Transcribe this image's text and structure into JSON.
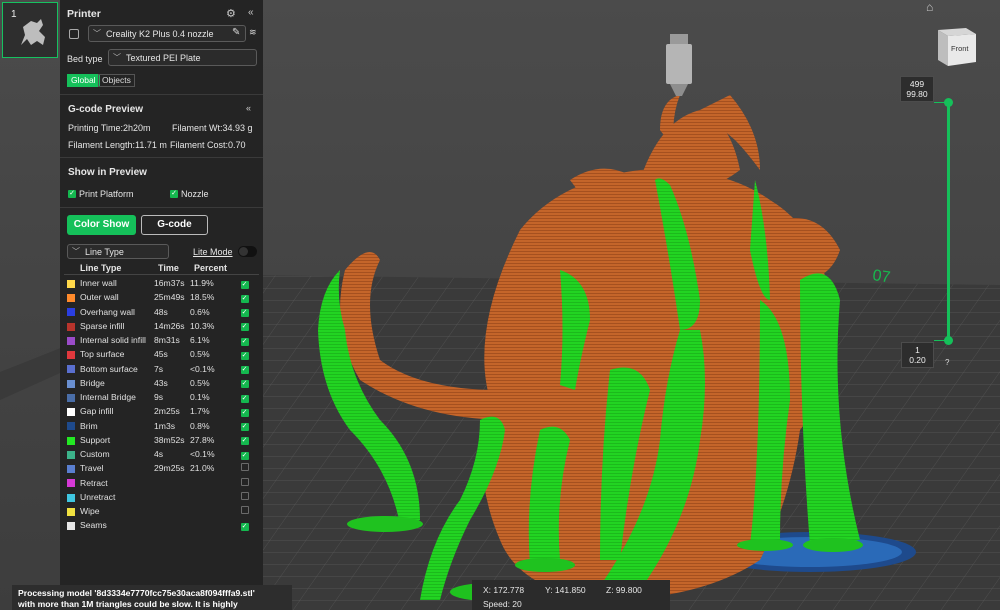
{
  "plate": {
    "number": "1"
  },
  "printer": {
    "title": "Printer",
    "model": "Creality K2 Plus 0.4 nozzle",
    "bed_type_label": "Bed type",
    "bed_type_value": "Textured PEI Plate",
    "tabs": [
      {
        "label": "Global",
        "active": true
      },
      {
        "label": "Objects",
        "active": false
      }
    ]
  },
  "gcode": {
    "title": "G-code Preview",
    "printing_time": "Printing Time:2h20m",
    "filament_wt": "Filament Wt:34.93 g",
    "filament_length": "Filament Length:11.71 m",
    "filament_cost": "Filament Cost:0.70"
  },
  "show_in_preview": {
    "title": "Show in Preview",
    "print_platform": "Print Platform",
    "nozzle": "Nozzle"
  },
  "view_buttons": {
    "color_show": "Color Show",
    "gcode": "G-code"
  },
  "line_type_select": {
    "value": "Line Type",
    "lite_mode": "Lite Mode"
  },
  "table": {
    "headers": [
      "Line Type",
      "Time",
      "Percent"
    ],
    "rows": [
      {
        "name": "Inner wall",
        "time": "16m37s",
        "percent": "11.9%",
        "color": "#ffd84a",
        "checked": true
      },
      {
        "name": "Outer wall",
        "time": "25m49s",
        "percent": "18.5%",
        "color": "#ff8a2b",
        "checked": true
      },
      {
        "name": "Overhang wall",
        "time": "48s",
        "percent": "0.6%",
        "color": "#2a3ee0",
        "checked": true
      },
      {
        "name": "Sparse infill",
        "time": "14m26s",
        "percent": "10.3%",
        "color": "#b8342c",
        "checked": true
      },
      {
        "name": "Internal solid infill",
        "time": "8m31s",
        "percent": "6.1%",
        "color": "#9a4bc8",
        "checked": true
      },
      {
        "name": "Top surface",
        "time": "45s",
        "percent": "0.5%",
        "color": "#e0383d",
        "checked": true
      },
      {
        "name": "Bottom surface",
        "time": "7s",
        "percent": "<0.1%",
        "color": "#5a6fcf",
        "checked": true
      },
      {
        "name": "Bridge",
        "time": "43s",
        "percent": "0.5%",
        "color": "#6a8fd0",
        "checked": true
      },
      {
        "name": "Internal Bridge",
        "time": "9s",
        "percent": "0.1%",
        "color": "#4a6ea8",
        "checked": true
      },
      {
        "name": "Gap infill",
        "time": "2m25s",
        "percent": "1.7%",
        "color": "#ffffff",
        "checked": true
      },
      {
        "name": "Brim",
        "time": "1m3s",
        "percent": "0.8%",
        "color": "#1e4a8c",
        "checked": true
      },
      {
        "name": "Support",
        "time": "38m52s",
        "percent": "27.8%",
        "color": "#23e823",
        "checked": true
      },
      {
        "name": "Custom",
        "time": "4s",
        "percent": "<0.1%",
        "color": "#3cb38a",
        "checked": true
      },
      {
        "name": "Travel",
        "time": "29m25s",
        "percent": "21.0%",
        "color": "#5a7fd0",
        "checked": false
      },
      {
        "name": "Retract",
        "time": "",
        "percent": "",
        "color": "#d639d6",
        "checked": false
      },
      {
        "name": "Unretract",
        "time": "",
        "percent": "",
        "color": "#3fc6e0",
        "checked": false
      },
      {
        "name": "Wipe",
        "time": "",
        "percent": "",
        "color": "#f0e040",
        "checked": false
      },
      {
        "name": "Seams",
        "time": "",
        "percent": "",
        "color": "#e6e6e6",
        "checked": true
      }
    ]
  },
  "layer_slider": {
    "top_layer": "499",
    "top_height": "99.80",
    "bottom_layer": "1",
    "bottom_height": "0.20",
    "help": "?"
  },
  "view_cube": {
    "face": "Front"
  },
  "coords": {
    "x": "X: 172.778",
    "y": "Y: 141.850",
    "z": "Z: 99.800",
    "speed": "Speed: 20"
  },
  "notice": {
    "line1": "Processing model '8d3334e7770fcc75e30aca8f094fffa9.stl'",
    "line2": "with more than 1M triangles could be slow. It is highly"
  },
  "bed_mark": "07",
  "colors": {
    "accent": "#15c05a",
    "panel": "#242424",
    "model": "#c4652a",
    "support": "#22d422"
  }
}
